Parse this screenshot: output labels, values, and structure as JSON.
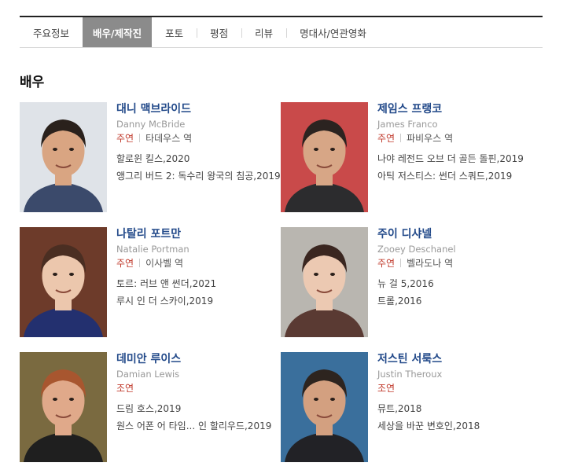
{
  "tabs": [
    {
      "label": "주요정보",
      "active": false
    },
    {
      "label": "배우/제작진",
      "active": true
    },
    {
      "label": "포토",
      "active": false
    },
    {
      "label": "평점",
      "active": false
    },
    {
      "label": "리뷰",
      "active": false
    },
    {
      "label": "명대사/연관영화",
      "active": false
    }
  ],
  "section_title": "배우",
  "cast": [
    {
      "name_kr": "대니 맥브라이드",
      "name_en": "Danny McBride",
      "role": "주연",
      "character": "타데우스 역",
      "films": [
        "할로윈 킬스,2020",
        "앵그리 버드 2: 독수리 왕국의 침공,2019"
      ],
      "photo": {
        "bg": "#dfe3e8",
        "skin": "#d9a582",
        "hair": "#2a211c",
        "shirt": "#3b4a6b"
      }
    },
    {
      "name_kr": "제임스 프랭코",
      "name_en": "James Franco",
      "role": "주연",
      "character": "파비우스 역",
      "films": [
        "나야 레전드 오브 더 골든 돌핀,2019",
        "아틱 저스티스: 썬더 스쿼드,2019"
      ],
      "photo": {
        "bg": "#c94a4a",
        "skin": "#d7a686",
        "hair": "#2b2320",
        "shirt": "#2c2c2e"
      }
    },
    {
      "name_kr": "나탈리 포트만",
      "name_en": "Natalie Portman",
      "role": "주연",
      "character": "이사벨 역",
      "films": [
        "토르: 러브 앤 썬더,2021",
        "루시 인 더 스카이,2019"
      ],
      "photo": {
        "bg": "#6d3b2a",
        "skin": "#ecc7ad",
        "hair": "#4a2e22",
        "shirt": "#23306f"
      }
    },
    {
      "name_kr": "주이 디샤넬",
      "name_en": "Zooey Deschanel",
      "role": "주연",
      "character": "벨라도나 역",
      "films": [
        "뉴 걸 5,2016",
        "트롤,2016"
      ],
      "photo": {
        "bg": "#b9b6b0",
        "skin": "#ecc9b2",
        "hair": "#3a2620",
        "shirt": "#5a3a33"
      }
    },
    {
      "name_kr": "데미안 루이스",
      "name_en": "Damian Lewis",
      "role": "조연",
      "character": "",
      "films": [
        "드림 호스,2019",
        "원스 어폰 어 타임... 인 할리우드,2019"
      ],
      "photo": {
        "bg": "#7a6a40",
        "skin": "#e0a98a",
        "hair": "#a8562f",
        "shirt": "#1f1f1f"
      }
    },
    {
      "name_kr": "저스틴 서룩스",
      "name_en": "Justin Theroux",
      "role": "조연",
      "character": "",
      "films": [
        "뮤트,2018",
        "세상을 바꾼 변호인,2018"
      ],
      "photo": {
        "bg": "#3a6f9c",
        "skin": "#d3a080",
        "hair": "#2d241f",
        "shirt": "#222226"
      }
    }
  ]
}
